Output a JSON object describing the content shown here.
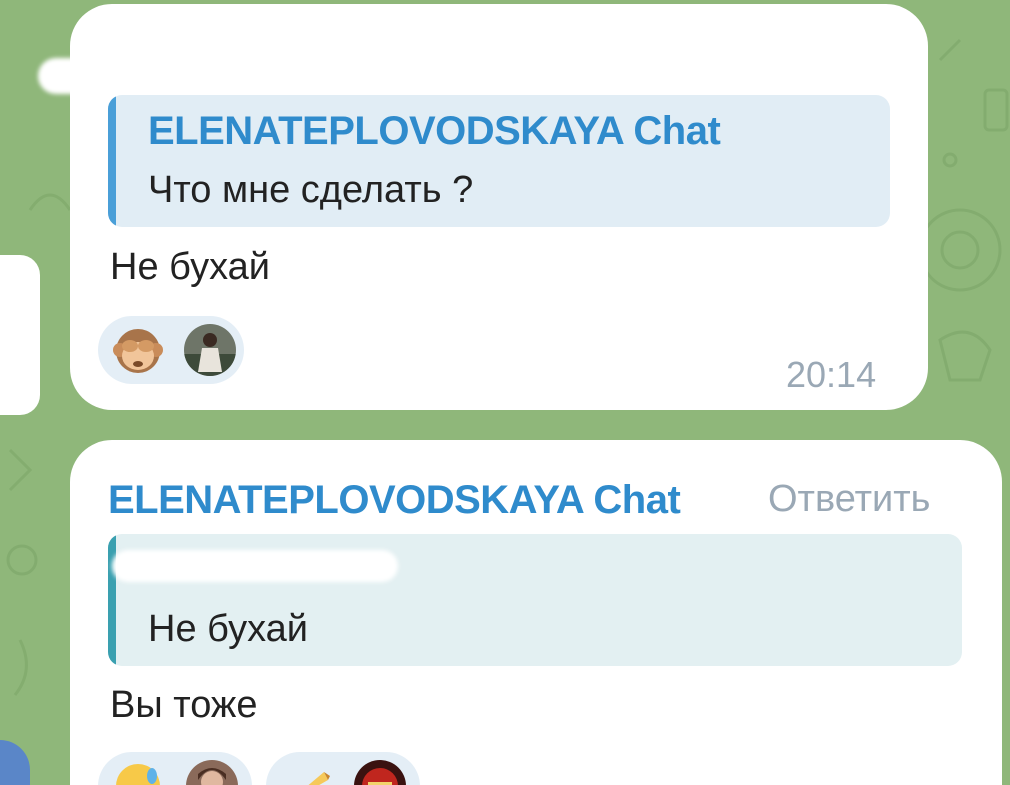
{
  "colors": {
    "background": "#8fb77a",
    "bubble": "#ffffff",
    "accent_name": "#2f8bcc",
    "quote_background": "#e1edf5",
    "timestamp": "#9aa8b5"
  },
  "messages": [
    {
      "quote": {
        "author": "ELENATEPLOVODSKAYA Chat",
        "text": "Что мне сделать ?"
      },
      "text": "Не бухай",
      "reactions": [
        {
          "emoji_icon": "see-no-evil-monkey-icon",
          "emoji": "🙈",
          "avatar": "user-avatar"
        }
      ],
      "time": "20:14"
    },
    {
      "sender": "ELENATEPLOVODSKAYA Chat",
      "reply_label": "Ответить",
      "quote": {
        "text": "Не бухай"
      },
      "text": "Вы тоже",
      "reactions": [
        {
          "emoji_icon": "rolling-laughing-icon",
          "emoji": "🤣",
          "avatar": "user-avatar"
        },
        {
          "emoji_icon": "pizza-slice-icon",
          "emoji": "🍕",
          "avatar": "user-avatar"
        }
      ]
    }
  ]
}
